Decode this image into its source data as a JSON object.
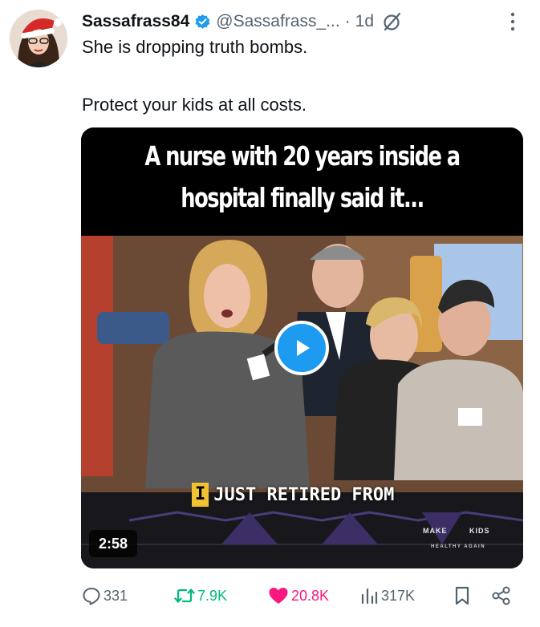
{
  "post": {
    "display_name": "Sassafrass84",
    "handle": "@Sassafrass_...",
    "separator": "·",
    "time": "1d",
    "text_line1": "She is dropping truth bombs.",
    "text_line2": "Protect your kids at all costs."
  },
  "media": {
    "headline_line1": "A nurse with 20 years inside a",
    "headline_line2": "hospital finally said it...",
    "caption_highlight": "I",
    "caption_text": "JUST RETIRED FROM",
    "duration": "2:58",
    "logo_make": "MAKE",
    "logo_kids": "KIDS",
    "logo_sub": "HEALTHY AGAIN"
  },
  "actions": {
    "replies": "331",
    "reposts": "7.9K",
    "likes": "20.8K",
    "views": "317K"
  },
  "colors": {
    "verified": "#1d9bf0",
    "repost": "#00ba7c",
    "like": "#f91880",
    "muted": "#536471",
    "play_button": "#1d9bf0"
  }
}
